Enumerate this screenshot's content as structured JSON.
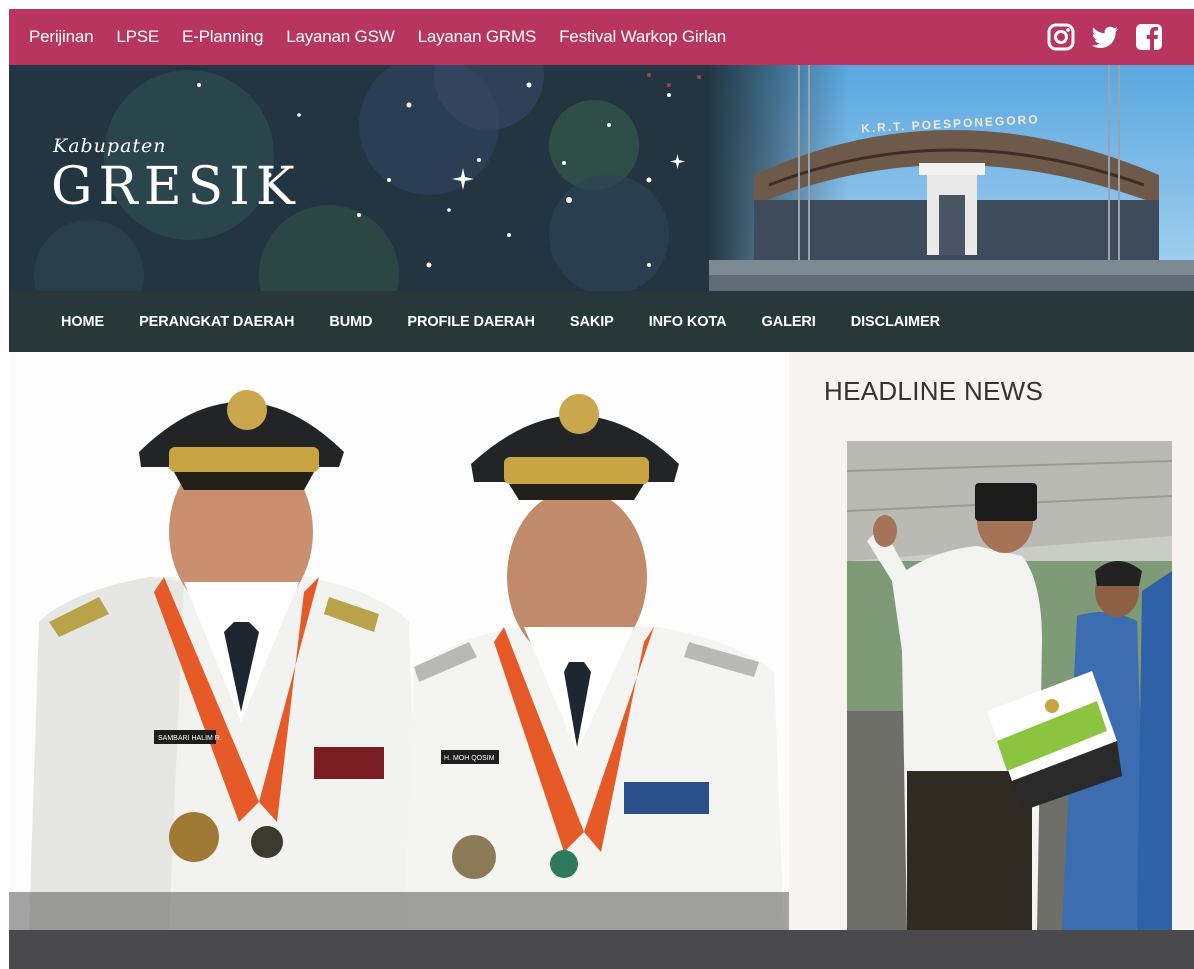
{
  "topbar": {
    "links": [
      "Perijinan",
      "LPSE",
      "E-Planning",
      "Layanan GSW",
      "Layanan GRMS",
      "Festival Warkop Girlan"
    ],
    "social_icons": [
      "instagram-icon",
      "twitter-icon",
      "facebook-icon"
    ],
    "color": "#b8355f"
  },
  "banner": {
    "logo_small": "Kabupaten",
    "logo_big": "GRESIK",
    "stadium_sign": "K.R.T. POESPONEGORO",
    "bg_color": "#233642"
  },
  "nav": {
    "items": [
      "HOME",
      "PERANGKAT DAERAH",
      "BUMD",
      "PROFILE DAERAH",
      "SAKIP",
      "INFO KOTA",
      "GALERI",
      "DISCLAIMER"
    ],
    "bg_color": "#283739"
  },
  "hero": {
    "left_nametag": "SAMBARI HALIM R.",
    "right_nametag": "H. MOH QOSIM"
  },
  "sidebar": {
    "headline_title": "HEADLINE NEWS"
  }
}
